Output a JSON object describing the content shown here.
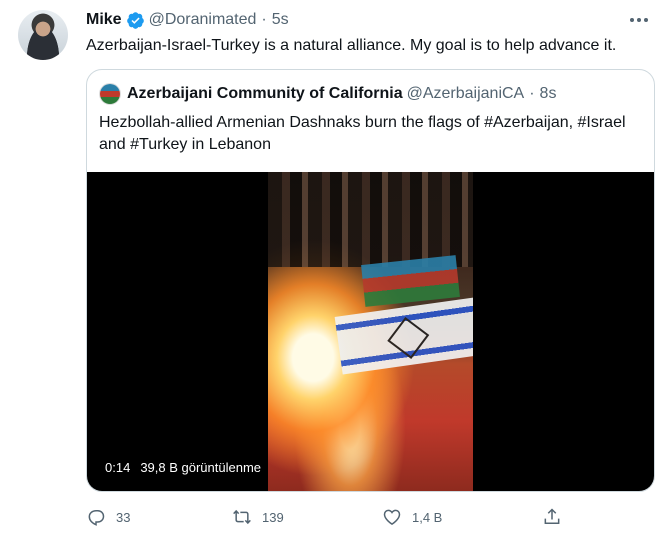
{
  "tweet": {
    "display_name": "Mike",
    "handle": "@Doranimated",
    "separator": "·",
    "time": "5s",
    "text": "Azerbaijan-Israel-Turkey is a natural alliance. My goal is to help advance it."
  },
  "quote": {
    "display_name": "Azerbaijani Community of California",
    "handle": "@AzerbaijaniCA",
    "separator": "·",
    "time": "8s",
    "text": "Hezbollah-allied Armenian Dashnaks burn the flags of #Azerbaijan, #Israel and #Turkey in Lebanon",
    "video": {
      "duration": "0:14",
      "views": "39,8 B görüntülenme"
    }
  },
  "actions": {
    "replies": "33",
    "retweets": "139",
    "likes": "1,4 B",
    "share": ""
  },
  "colors": {
    "verified": "#1d9bf0",
    "muted": "#536471",
    "border": "#cfd9de"
  },
  "icons": [
    "verified-icon",
    "more-icon",
    "reply-icon",
    "retweet-icon",
    "like-icon",
    "share-icon"
  ]
}
